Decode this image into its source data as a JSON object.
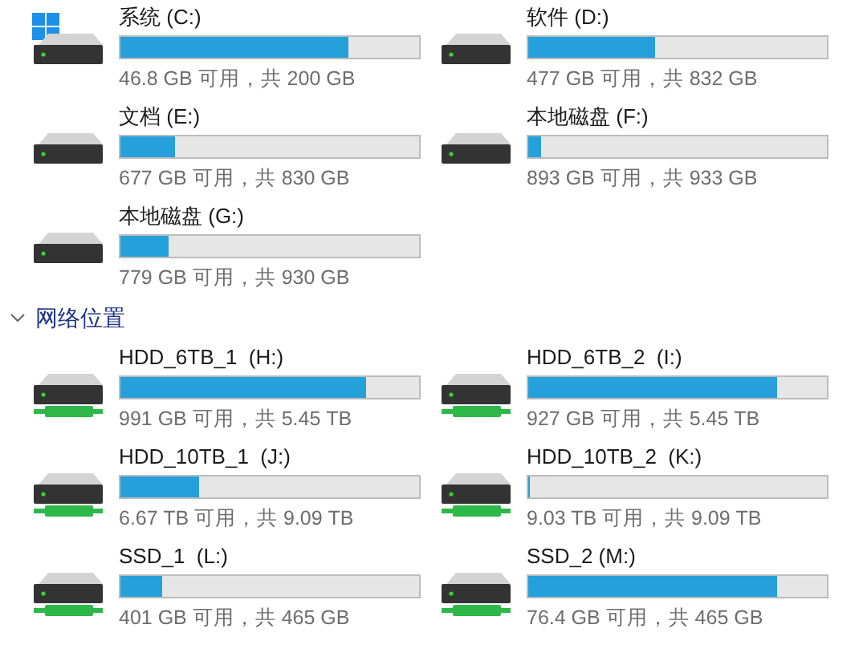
{
  "local_drives": [
    {
      "kind": "system",
      "name": "系统 (C:)",
      "level": 0.766,
      "info": "46.8 GB 可用，共 200 GB"
    },
    {
      "kind": "local",
      "name": "软件 (D:)",
      "level": 0.427,
      "info": "477 GB 可用，共 832 GB"
    },
    {
      "kind": "local",
      "name": "文档 (E:)",
      "level": 0.184,
      "info": "677 GB 可用，共 830 GB"
    },
    {
      "kind": "local",
      "name": "本地磁盘 (F:)",
      "level": 0.043,
      "info": "893 GB 可用，共 933 GB"
    },
    {
      "kind": "local",
      "name": "本地磁盘 (G:)",
      "level": 0.162,
      "info": "779 GB 可用，共 930 GB"
    }
  ],
  "network_section": {
    "title": "网络位置",
    "expanded": true,
    "drives": [
      {
        "kind": "network",
        "name": "HDD_6TB_1  (H:)",
        "level": 0.822,
        "info": "991 GB 可用，共 5.45 TB"
      },
      {
        "kind": "network",
        "name": "HDD_6TB_2  (I:)",
        "level": 0.834,
        "info": "927 GB 可用，共 5.45 TB"
      },
      {
        "kind": "network",
        "name": "HDD_10TB_1  (J:)",
        "level": 0.266,
        "info": "6.67 TB 可用，共 9.09 TB"
      },
      {
        "kind": "network",
        "name": "HDD_10TB_2  (K:)",
        "level": 0.007,
        "info": "9.03 TB 可用，共 9.09 TB"
      },
      {
        "kind": "network",
        "name": "SSD_1  (L:)",
        "level": 0.138,
        "info": "401 GB 可用，共 465 GB"
      },
      {
        "kind": "network",
        "name": "SSD_2 (M:)",
        "level": 0.836,
        "info": "76.4 GB 可用，共 465 GB"
      }
    ]
  }
}
